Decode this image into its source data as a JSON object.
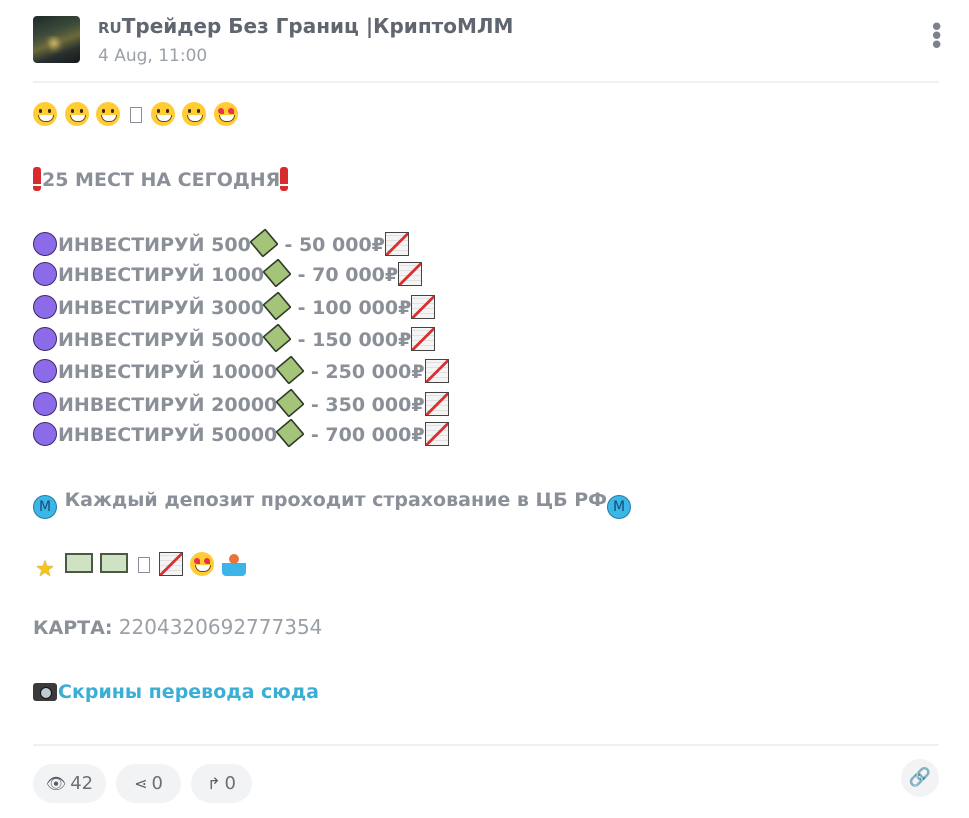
{
  "channel": {
    "flag": "RU",
    "name": "Трейдер Без Границ |КриптоМЛМ",
    "date": "4 Aug, 11:00"
  },
  "post": {
    "headline": "25 МЕСТ НА СЕГОДНЯ",
    "offers": [
      {
        "text": "ИНВЕСТИРУЙ 500",
        "result": " - 50 000₽"
      },
      {
        "text": "ИНВЕСТИРУЙ 1000",
        "result": " - 70 000₽"
      },
      {
        "text": "ИНВЕСТИРУЙ 3000",
        "result": " - 100 000₽"
      },
      {
        "text": "ИНВЕСТИРУЙ 5000",
        "result": " - 150 000₽"
      },
      {
        "text": "ИНВЕСТИРУЙ 10000",
        "result": " - 250 000₽"
      },
      {
        "text": "ИНВЕСТИРУЙ 20000",
        "result": " - 350 000₽"
      },
      {
        "text": "ИНВЕСТИРУЙ 50000",
        "result": " - 700 000₽"
      }
    ],
    "insurance": " Каждый депозит проходит страхование в ЦБ РФ",
    "metro_letter": "M",
    "card_label": "КАРТА:",
    "card_number": " 2204320692777354",
    "screens_link": "Скрины перевода сюда"
  },
  "footer": {
    "views": "42",
    "shares": "0",
    "forwards": "0"
  },
  "icons": {
    "menu": "vertical-dots-icon",
    "views": "eye-icon",
    "shares": "share-icon",
    "forwards": "forward-arrow-icon",
    "link": "link-icon"
  }
}
